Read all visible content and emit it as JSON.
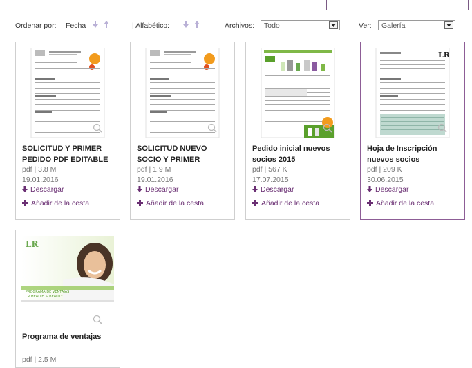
{
  "toolbar": {
    "sort_label": "Ordenar por:",
    "sort_date": "Fecha",
    "sort_alpha": "| Alfabético:",
    "files_label": "Archivos:",
    "files_value": "Todo",
    "view_label": "Ver:",
    "view_value": "Galería"
  },
  "colors": {
    "accent": "#6a2f73",
    "arrow": "#b9b0d6",
    "border": "#cfcfcf",
    "active_border": "#8d5d96"
  },
  "cards": [
    {
      "title": "SOLICITUD Y PRIMER PEDIDO PDF EDITABLE",
      "type_size": "pdf | 3.8 M",
      "date": "19.01.2016",
      "download": "Descargar",
      "add": "Añadir de la cesta"
    },
    {
      "title": "SOLICITUD NUEVO SOCIO Y PRIMER",
      "type_size": "pdf | 1.9 M",
      "date": "19.01.2016",
      "download": "Descargar",
      "add": "Añadir de la cesta"
    },
    {
      "title": "Pedido inicial nuevos socios 2015",
      "type_size": "pdf | 567 K",
      "date": "17.07.2015",
      "download": "Descargar",
      "add": "Añadir de la cesta"
    },
    {
      "title": "Hoja de Inscripción nuevos socios",
      "type_size": "pdf | 209 K",
      "date": "30.06.2015",
      "download": "Descargar",
      "add": "Añadir de la cesta"
    },
    {
      "title": "Programa de ventajas",
      "type_size": "pdf | 2.5 M",
      "date": "",
      "download": "",
      "add": ""
    }
  ],
  "promo": {
    "brand": "LR",
    "line1": "PROGRAMA DE VENTAJAS",
    "line2": "LR HEALTH & BEAUTY"
  },
  "form_brand": "LR"
}
